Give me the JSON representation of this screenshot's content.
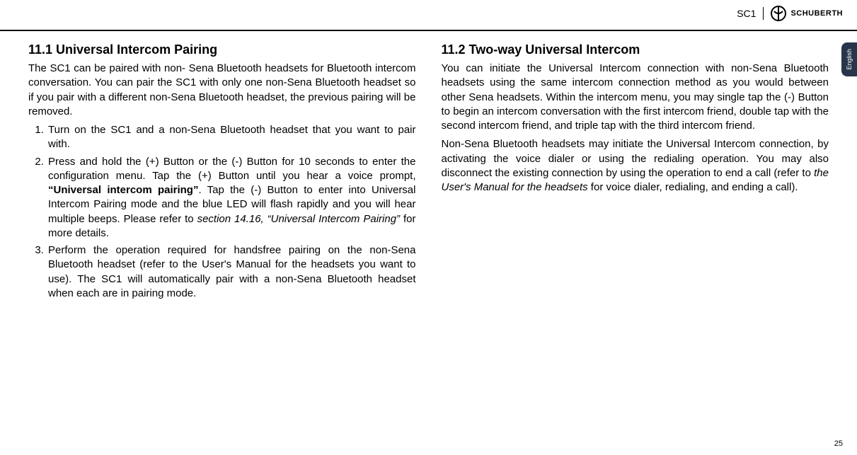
{
  "header": {
    "model": "SC1",
    "brand": "SCHUBERTH"
  },
  "language_tab": "English",
  "page_number": "25",
  "left": {
    "heading": "11.1 Universal Intercom Pairing",
    "intro": "The SC1 can be paired with non- Sena Bluetooth headsets for Bluetooth intercom conversation. You can pair the SC1 with only one non-Sena Bluetooth headset so if you pair with a different non-Sena Bluetooth headset, the previous pairing will be removed.",
    "steps": {
      "s1": "Turn on the SC1 and a non-Sena Bluetooth headset that you want to pair with.",
      "s2a": "Press and hold the (+) Button or the (-) Button for 10 seconds to enter the configuration menu. Tap the (+) Button until you hear a voice prompt, ",
      "s2b": "“Universal intercom pairing”",
      "s2c": ". Tap the (-) Button to enter into Universal Intercom Pairing mode and the blue LED will flash rapidly and you will hear multiple beeps. Please refer to ",
      "s2d": "section 14.16, “Universal Intercom Pairing”",
      "s2e": " for more details.",
      "s3": "Perform the operation required for handsfree pairing on the non-Sena Bluetooth headset (refer to the User's Manual for the headsets you want to use). The SC1 will automatically pair with a non-Sena Bluetooth headset when each are in pairing mode."
    }
  },
  "right": {
    "heading": "11.2 Two-way Universal Intercom",
    "p1": "You can initiate the Universal Intercom connection with non-Sena Bluetooth headsets using the same intercom connection method as you would between other Sena headsets. Within the intercom menu, you may single tap the (-) Button to begin an intercom conversation with the first intercom friend, double tap with the second intercom friend, and triple tap with the third intercom friend.",
    "p2a": "Non-Sena Bluetooth headsets may initiate the Universal Intercom connection, by activating the voice dialer or using the redialing operation. You may also disconnect the existing connection by using the operation to end a call (refer to ",
    "p2b": "the User's Manual for the headsets",
    "p2c": " for voice dialer, redialing, and ending a call)."
  }
}
